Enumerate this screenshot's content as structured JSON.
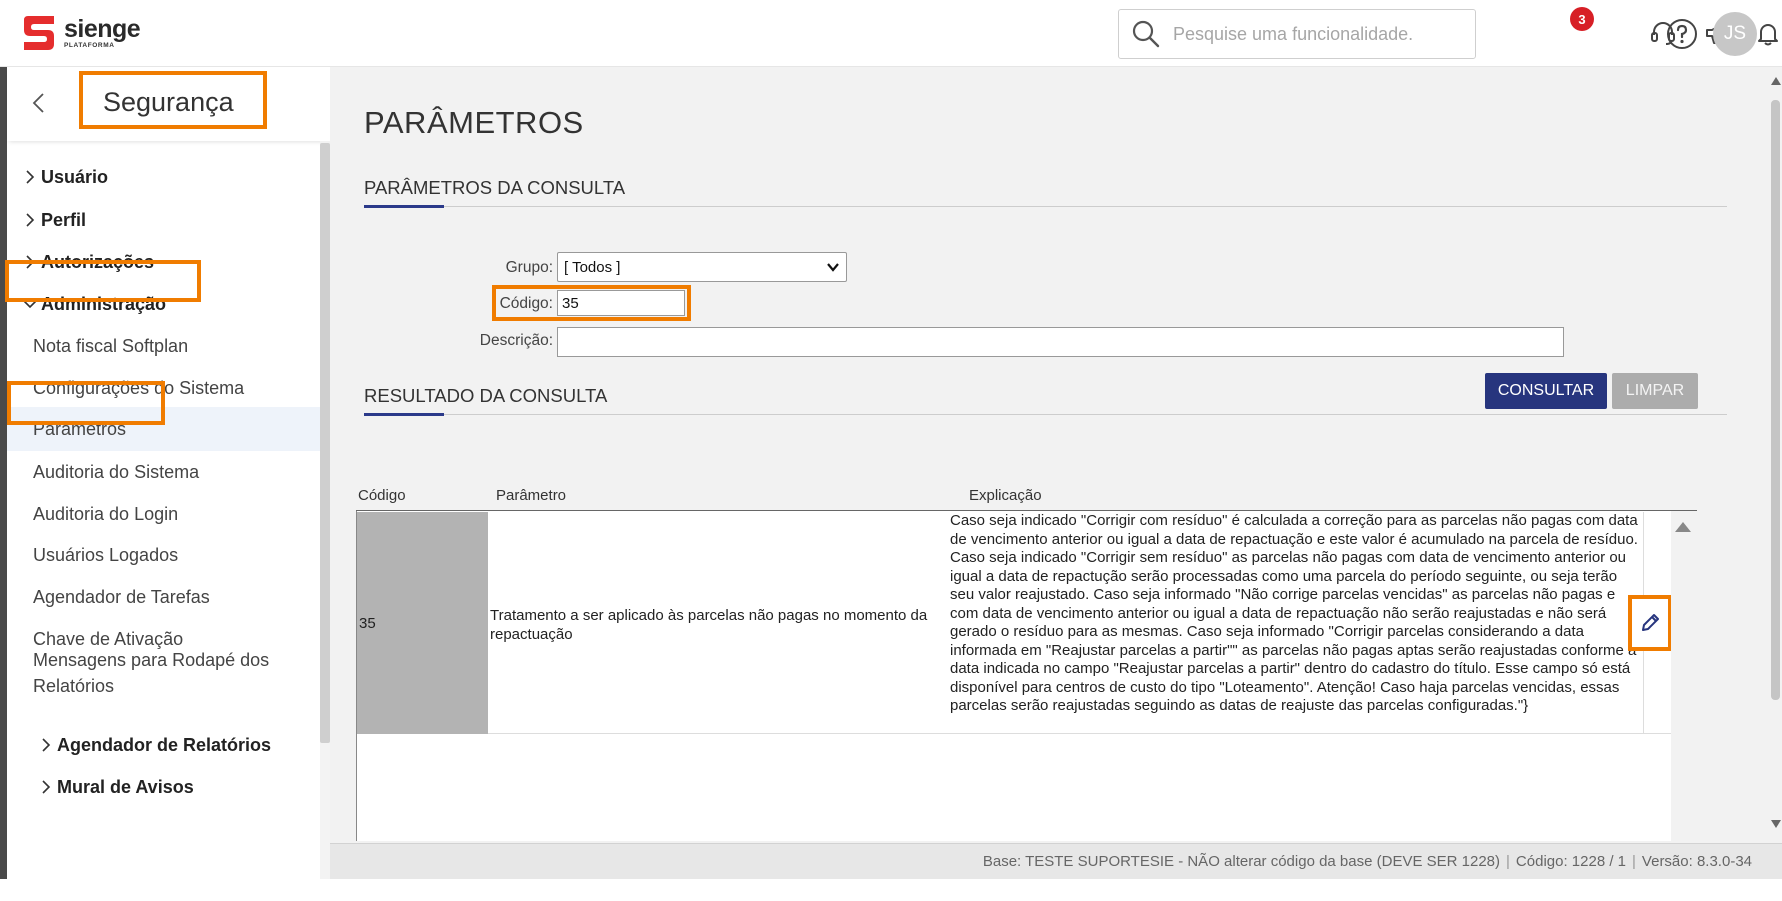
{
  "app": {
    "name": "sienge",
    "subtitle": "PLATAFORMA"
  },
  "header": {
    "search_placeholder": "Pesquise uma funcionalidade.",
    "notification_count": "3",
    "user_initials": "JS"
  },
  "sidebar": {
    "title": "Segurança",
    "items": [
      {
        "label": "Usuário"
      },
      {
        "label": "Perfil"
      },
      {
        "label": "Autorizações"
      },
      {
        "label": "Administração"
      },
      {
        "label": "Nota fiscal Softplan"
      },
      {
        "label": "Configurações do Sistema"
      },
      {
        "label": "Parâmetros"
      },
      {
        "label": "Auditoria do Sistema"
      },
      {
        "label": "Auditoria do Login"
      },
      {
        "label": "Usuários Logados"
      },
      {
        "label": "Agendador de Tarefas"
      },
      {
        "label": "Chave de Ativação"
      },
      {
        "label": "Mensagens para Rodapé dos Relatórios"
      },
      {
        "label": "Agendador de Relatórios"
      },
      {
        "label": "Mural de Avisos"
      }
    ]
  },
  "main": {
    "page_title": "PARÂMETROS",
    "query_section": "PARÂMETROS DA CONSULTA",
    "form": {
      "group_label": "Grupo:",
      "group_value": "[ Todos ]",
      "code_label": "Código:",
      "code_value": "35",
      "desc_label": "Descrição:",
      "desc_value": ""
    },
    "buttons": {
      "search": "CONSULTAR",
      "clear": "LIMPAR"
    },
    "result_section": "RESULTADO DA CONSULTA",
    "table": {
      "headers": [
        "Código",
        "Parâmetro",
        "Explicação"
      ],
      "rows": [
        {
          "code": "35",
          "param": "Tratamento a ser aplicado às parcelas não pagas no momento da repactuação",
          "expl": "Caso seja indicado \"Corrigir com resíduo\" é calculada a correção para as parcelas não pagas com data de vencimento anterior ou igual a data de repactuação e este valor é acumulado na parcela de resíduo. Caso seja indicado \"Corrigir sem resíduo\" as parcelas não pagas com data de vencimento anterior ou igual a data de repactução serão processadas como uma parcela do período seguinte, ou seja terão seu valor reajustado. Caso seja informado \"Não corrige parcelas vencidas\" as parcelas não pagas e com data de vencimento anterior ou igual a data de repactuação não serão reajustadas e não será gerado o resíduo para as mesmas. Caso seja informado \"Corrigir parcelas considerando a data informada em \"Reajustar parcelas a partir\"\" as parcelas não pagas aptas serão reajustadas conforme a data indicada no campo \"Reajustar parcelas a partir\" dentro do cadastro do título. Esse campo só está disponível para centros de custo do tipo \"Loteamento\". Atenção! Caso haja parcelas vencidas, essas parcelas serão reajustadas seguindo as datas de reajuste das parcelas configuradas.\"}"
        }
      ]
    }
  },
  "footer": {
    "base": "Base: TESTE SUPORTESIE - NÃO alterar código da base (DEVE SER 1228)",
    "code": "Código: 1228 / 1",
    "version": "Versão: 8.3.0-34"
  },
  "colors": {
    "brand_red": "#e52d2d",
    "highlight": "#f07c00",
    "primary": "#27357e"
  },
  "icons": [
    "logo-icon",
    "search-icon",
    "headset-icon",
    "megaphone-icon",
    "bell-icon",
    "help-icon",
    "chevron-left-icon",
    "chevron-right-icon",
    "chevron-down-icon",
    "edit-pencil-icon"
  ]
}
